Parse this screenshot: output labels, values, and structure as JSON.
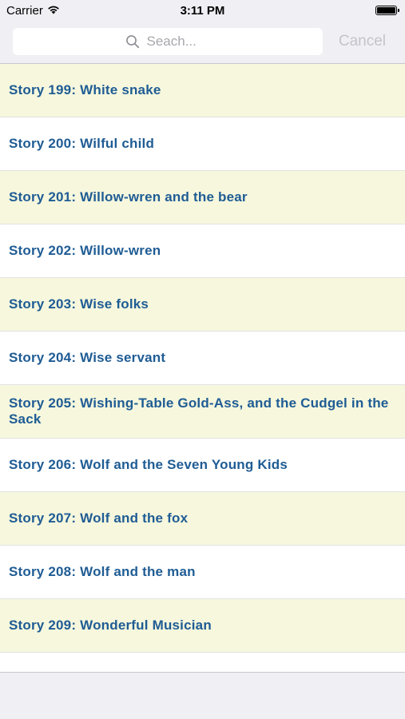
{
  "status_bar": {
    "carrier": "Carrier",
    "time": "3:11 PM"
  },
  "search": {
    "placeholder": "Seach...",
    "cancel_label": "Cancel"
  },
  "stories": [
    {
      "title": "Story 199: White snake"
    },
    {
      "title": "Story 200: Wilful child"
    },
    {
      "title": "Story 201: Willow-wren and the bear"
    },
    {
      "title": "Story 202: Willow-wren"
    },
    {
      "title": "Story 203: Wise folks"
    },
    {
      "title": "Story 204: Wise servant"
    },
    {
      "title": "Story 205: Wishing-Table Gold-Ass, and the Cudgel in the Sack"
    },
    {
      "title": "Story 206: Wolf and the Seven Young Kids"
    },
    {
      "title": "Story 207: Wolf and the fox"
    },
    {
      "title": "Story 208: Wolf and the man"
    },
    {
      "title": "Story 209: Wonderful Musician"
    }
  ],
  "colors": {
    "row_alt": "#f6f7dd",
    "row_plain": "#ffffff",
    "title_text": "#1f5c94"
  }
}
